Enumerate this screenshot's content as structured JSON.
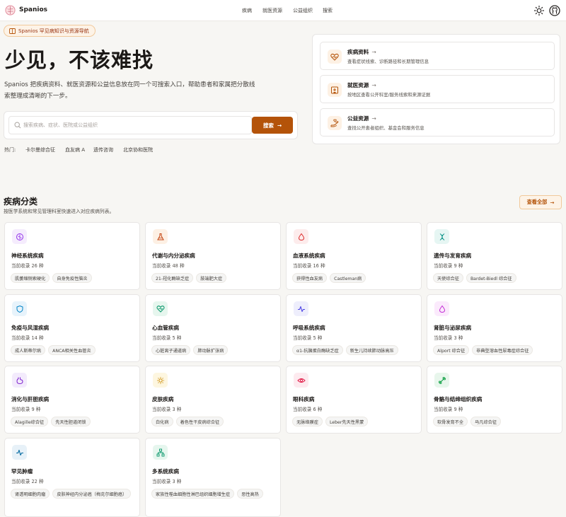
{
  "header": {
    "brand": "Spanios",
    "nav": [
      "疾病",
      "就医资源",
      "公益组织",
      "搜索"
    ],
    "icons": {
      "theme": "sun-icon",
      "github": "github-icon"
    }
  },
  "hero": {
    "badge": "Spanios 罕见病知识与资源导航",
    "title": "少见，不该难找",
    "description": "Spanios 把疾病资料、就医资源和公益信息放在同一个可搜索入口，帮助患者和家属把分散线索整理成清晰的下一步。",
    "search": {
      "placeholder": "搜索疾病、症状、医院或公益组织",
      "button": "搜索"
    },
    "hot_label": "热门:",
    "hot_items": [
      "卡尔曼综合征",
      "血友病 A",
      "遗传咨询",
      "北京协和医院"
    ]
  },
  "quick_links": [
    {
      "title": "疾病资料",
      "desc": "查看症状线索、诊断路径和长期管理信息",
      "icon": "heart-pulse-icon"
    },
    {
      "title": "就医资源",
      "desc": "按地区查看公开科室/服务线索和来源证据",
      "icon": "hospital-icon"
    },
    {
      "title": "公益资源",
      "desc": "查找公开患者组织、基金会和服务信息",
      "icon": "hand-heart-icon"
    }
  ],
  "categories_section": {
    "title": "疾病分类",
    "subtitle": "按医学系统和常见管理科室快速进入对应疾病列表。",
    "view_all": "查看全部"
  },
  "colors": {
    "accent": "#b45309",
    "page_bg": "#f7f6f3"
  },
  "categories": [
    {
      "name": "神经系统疾病",
      "count": "当前收录 26 种",
      "tags": [
        "肌萎缩侧索硬化",
        "自身免疫性脑炎"
      ],
      "icon": "brain-icon",
      "color": "#9333ea",
      "bg": "#f5ecfd"
    },
    {
      "name": "代谢与内分泌疾病",
      "count": "当前收录 48 种",
      "tags": [
        "21-羟化酶缺乏症",
        "肢端肥大症"
      ],
      "icon": "flask-icon",
      "color": "#c2410c",
      "bg": "#fdf0e4"
    },
    {
      "name": "血液系统疾病",
      "count": "当前收录 16 种",
      "tags": [
        "获得性血友病",
        "Castleman病"
      ],
      "icon": "droplet-icon",
      "color": "#dc2626",
      "bg": "#fdecec"
    },
    {
      "name": "遗传与发育疾病",
      "count": "当前收录 9 种",
      "tags": [
        "天使综合征",
        "Bardet-Biedl 综合征"
      ],
      "icon": "dna-icon",
      "color": "#0d9488",
      "bg": "#e6f6f3"
    },
    {
      "name": "免疫与风湿疾病",
      "count": "当前收录 14 种",
      "tags": [
        "成人斯蒂尔病",
        "ANCA相关性血管炎"
      ],
      "icon": "shield-icon",
      "color": "#0284c7",
      "bg": "#e7f3fb"
    },
    {
      "name": "心血管疾病",
      "count": "当前收录 5 种",
      "tags": [
        "心脏离子通道病",
        "肺动脉扩张病"
      ],
      "icon": "heart-icon",
      "color": "#059669",
      "bg": "#e6f6ee"
    },
    {
      "name": "呼吸系统疾病",
      "count": "当前收录 5 种",
      "tags": [
        "α1-抗胰蛋白酶缺乏症",
        "新生儿持续肺动脉高压"
      ],
      "icon": "activity-icon",
      "color": "#4f46e5",
      "bg": "#eeeefc"
    },
    {
      "name": "肾脏与泌尿疾病",
      "count": "当前收录 3 种",
      "tags": [
        "Alport 综合征",
        "非典型溶血性尿毒症综合征"
      ],
      "icon": "droplet-icon",
      "color": "#c026d3",
      "bg": "#fbeafc"
    },
    {
      "name": "消化与肝胆疾病",
      "count": "当前收录 9 种",
      "tags": [
        "Alagille综合征",
        "先天性胆道闭锁"
      ],
      "icon": "stomach-icon",
      "color": "#7e22ce",
      "bg": "#f3ebfc"
    },
    {
      "name": "皮肤疾病",
      "count": "当前收录 3 种",
      "tags": [
        "白化病",
        "着色性干皮病综合征"
      ],
      "icon": "sun-icon",
      "color": "#ca8a04",
      "bg": "#fdf6e0"
    },
    {
      "name": "眼科疾病",
      "count": "当前收录 6 种",
      "tags": [
        "无脉络膜症",
        "Leber先天性黑蒙"
      ],
      "icon": "eye-icon",
      "color": "#e11d48",
      "bg": "#fdeaef"
    },
    {
      "name": "骨骼与结缔组织疾病",
      "count": "当前收录 9 种",
      "tags": [
        "软骨发育不全",
        "马凡综合征"
      ],
      "icon": "bone-icon",
      "color": "#16a34a",
      "bg": "#e8f6ec"
    },
    {
      "name": "罕见肿瘤",
      "count": "当前收录 22 种",
      "tags": [
        "肾透明细胞肉瘤",
        "皮肤神经内分泌癌（梅克尔细胞癌）"
      ],
      "icon": "activity-icon",
      "color": "#0369a1",
      "bg": "#e7f1f8"
    },
    {
      "name": "多系统疾病",
      "count": "当前收录 3 种",
      "tags": [
        "家族性噬血细胞性淋巴组织细胞增生症",
        "恶性高热"
      ],
      "icon": "network-icon",
      "color": "#059669",
      "bg": "#e6f6ee"
    }
  ]
}
